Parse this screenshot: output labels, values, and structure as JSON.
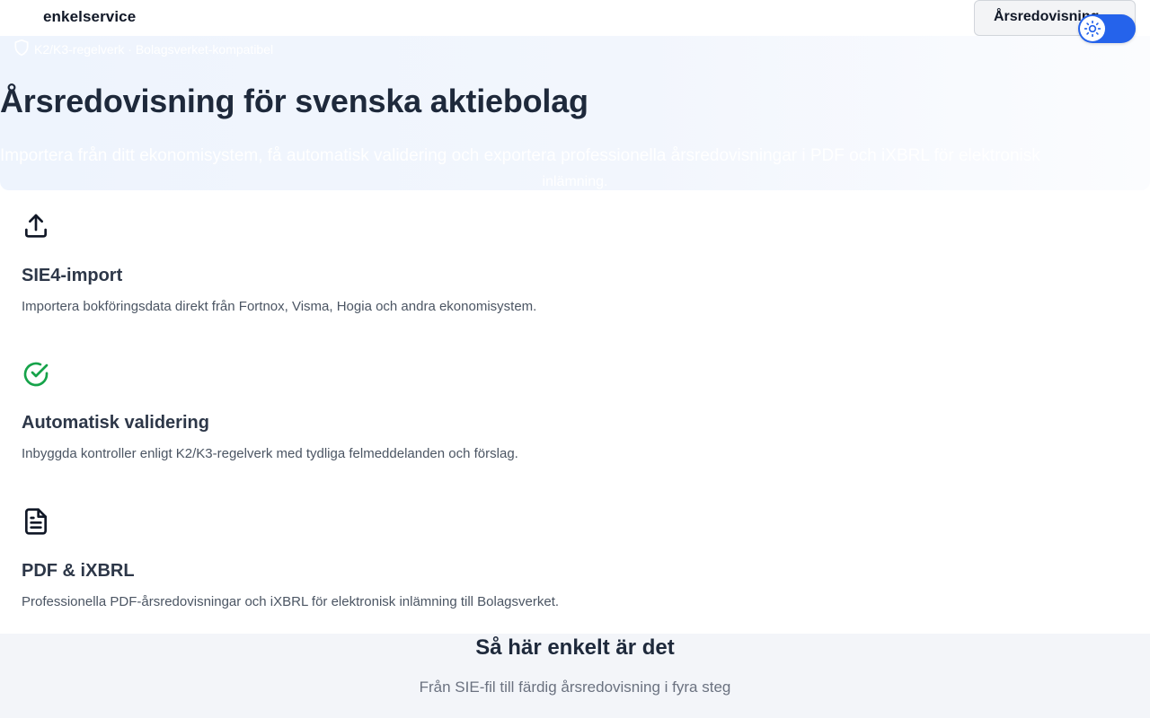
{
  "header": {
    "brand": "enkelservice",
    "nav_button": "Årsredovisning"
  },
  "hero": {
    "badge": "K2/K3-regelverk · Bolagsverket-kompatibel",
    "title": "Årsredovisning för svenska aktiebolag",
    "subtitle_line1": "Importera från ditt ekonomisystem, få automatisk validering och exportera professionella årsredovisningar i PDF och iXBRL för elektronisk",
    "subtitle_line2": "inlämning."
  },
  "features": [
    {
      "icon": "upload-icon",
      "title": "SIE4-import",
      "description": "Importera bokföringsdata direkt från Fortnox, Visma, Hogia och andra ekonomisystem."
    },
    {
      "icon": "check-circle-icon",
      "title": "Automatisk validering",
      "description": "Inbyggda kontroller enligt K2/K3-regelverk med tydliga felmeddelanden och förslag."
    },
    {
      "icon": "document-icon",
      "title": "PDF & iXBRL",
      "description": "Professionella PDF-årsredovisningar och iXBRL för elektronisk inlämning till Bolagsverket."
    }
  ],
  "steps": {
    "title": "Så här enkelt är det",
    "subtitle": "Från SIE-fil till färdig årsredovisning i fyra steg"
  },
  "colors": {
    "accent": "#2563eb",
    "success": "#16a34a",
    "hero_bg": "#eef4fd"
  }
}
